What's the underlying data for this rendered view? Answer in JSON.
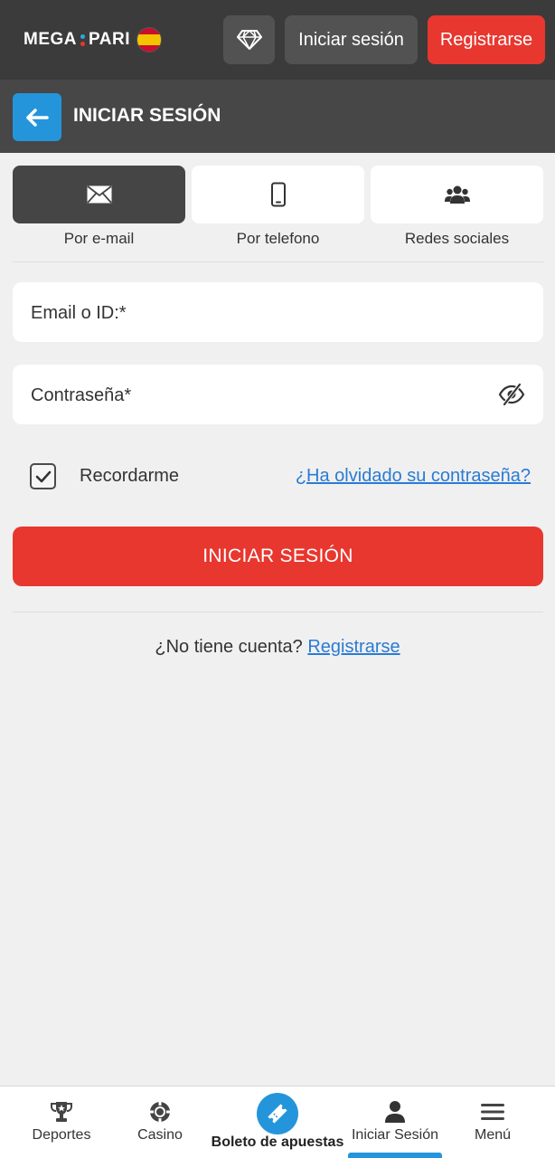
{
  "header": {
    "logo_part1": "MEGA",
    "logo_part2": "PARI",
    "login_label": "Iniciar sesión",
    "register_label": "Registrarse"
  },
  "title_bar": {
    "title": "INICIAR SESIÓN"
  },
  "tabs": [
    {
      "label": "Por e-mail",
      "icon": "envelope-icon",
      "active": true
    },
    {
      "label": "Por telefono",
      "icon": "phone-icon",
      "active": false
    },
    {
      "label": "Redes sociales",
      "icon": "users-icon",
      "active": false
    }
  ],
  "form": {
    "email_label": "Email o ID:*",
    "password_label": "Contraseña*",
    "remember_label": "Recordarme",
    "remember_checked": true,
    "forgot_label": "¿Ha olvidado su contraseña?",
    "submit_label": "INICIAR SESIÓN"
  },
  "footer": {
    "no_account_text": "¿No tiene cuenta?",
    "register_link": "Registrarse"
  },
  "bottom_nav": {
    "items": [
      {
        "label": "Deportes",
        "icon": "trophy-icon"
      },
      {
        "label": "Casino",
        "icon": "casino-chip-icon"
      },
      {
        "label": "Boleto de apuestas",
        "icon": "ticket-icon"
      },
      {
        "label": "Iniciar Sesión",
        "icon": "user-icon"
      },
      {
        "label": "Menú",
        "icon": "hamburger-icon"
      }
    ]
  },
  "colors": {
    "header_bg": "#3b3b3b",
    "titlebar_bg": "#474747",
    "accent_red": "#e8372f",
    "accent_blue": "#2495db",
    "link_blue": "#2a7bd4"
  }
}
